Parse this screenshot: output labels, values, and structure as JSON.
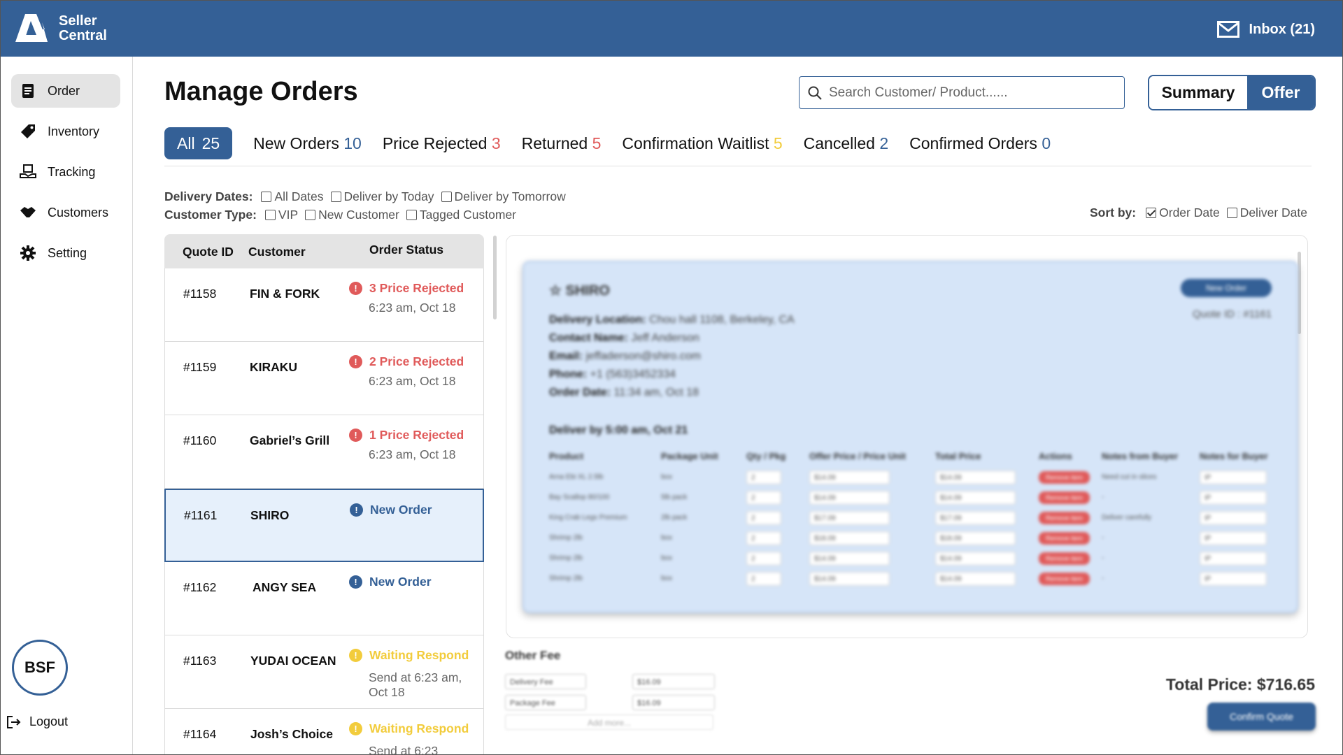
{
  "header": {
    "brand_line1": "Seller",
    "brand_line2": "Central",
    "inbox_label": "Inbox (21)"
  },
  "sidebar": {
    "items": [
      {
        "label": "Order",
        "icon": "order-icon"
      },
      {
        "label": "Inventory",
        "icon": "tag-icon"
      },
      {
        "label": "Tracking",
        "icon": "tracking-icon"
      },
      {
        "label": "Customers",
        "icon": "handshake-icon"
      },
      {
        "label": "Setting",
        "icon": "gear-icon"
      }
    ],
    "avatar": "BSF",
    "logout": "Logout"
  },
  "main": {
    "title": "Manage Orders",
    "search_placeholder": "Search Customer/ Product......",
    "view_toggle": {
      "summary": "Summary",
      "offer": "Offer"
    },
    "tabs": [
      {
        "label": "All",
        "count": "25"
      },
      {
        "label": "New Orders",
        "count": "10"
      },
      {
        "label": "Price Rejected",
        "count": "3"
      },
      {
        "label": "Returned",
        "count": "5"
      },
      {
        "label": "Confirmation Waitlist",
        "count": "5"
      },
      {
        "label": "Cancelled",
        "count": "2"
      },
      {
        "label": "Confirmed Orders",
        "count": "0"
      }
    ],
    "filters": {
      "delivery_label": "Delivery Dates:",
      "delivery_options": [
        "All Dates",
        "Deliver by Today",
        "Deliver by Tomorrow"
      ],
      "customer_label": "Customer Type:",
      "customer_options": [
        "VIP",
        "New Customer",
        "Tagged Customer"
      ],
      "sort_label": "Sort by:",
      "sort_options": [
        "Order Date",
        "Deliver Date"
      ]
    },
    "list": {
      "headers": [
        "Quote ID",
        "Customer",
        "Order Status"
      ],
      "rows": [
        {
          "id": "#1158",
          "customer": "FIN & FORK",
          "status": "3 Price Rejected",
          "time": "6:23 am, Oct 18"
        },
        {
          "id": "#1159",
          "customer": "KIRAKU",
          "status": "2 Price Rejected",
          "time": "6:23 am, Oct 18"
        },
        {
          "id": "#1160",
          "customer": "Gabriel’s Grill",
          "status": "1 Price Rejected",
          "time": "6:23 am, Oct 18"
        },
        {
          "id": "#1161",
          "customer": "SHIRO",
          "status": "New Order",
          "time": ""
        },
        {
          "id": "#1162",
          "customer": "ANGY SEA",
          "status": "New Order",
          "time": ""
        },
        {
          "id": "#1163",
          "customer": "YUDAI OCEAN",
          "status": "Waiting Respond",
          "time": "Send at 6:23 am, Oct 18"
        },
        {
          "id": "#1164",
          "customer": "Josh’s Choice",
          "status": "Waiting Respond",
          "time": "Send at 6:23"
        }
      ]
    },
    "detail": {
      "shop": "SHIRO",
      "new_order_btn": "New Order",
      "quote_ref": "Quote ID : #1161",
      "delivery_location_label": "Delivery Location:",
      "delivery_location": "Chou hall 1108, Berkeley, CA",
      "contact_label": "Contact Name:",
      "contact": "Jeff Anderson",
      "email_label": "Email:",
      "email": "jeffaderson@shiro.com",
      "phone_label": "Phone:",
      "phone": "+1 (563)3452334",
      "order_date_label": "Order Date:",
      "order_date": "11:34 am, Oct 18",
      "deliver_by": "Deliver by 5:00 am, Oct 21",
      "table_headers": [
        "Product",
        "Package Unit",
        "Qty / Pkg",
        "Offer Price / Price Unit",
        "Total Price",
        "Actions",
        "Notes from Buyer",
        "Notes for Buyer"
      ],
      "rows": [
        {
          "product": "Arna Ebi XL 2.5lb",
          "unit": "box",
          "qty": "2",
          "price": "$14.09",
          "total": "$14.09",
          "action": "Remove item",
          "note_from": "Need cut in slices",
          "note_for": "IP"
        },
        {
          "product": "Bay Scallop 80/100",
          "unit": "5lb pack",
          "qty": "2",
          "price": "$14.09",
          "total": "$14.09",
          "action": "Remove item",
          "note_from": "-",
          "note_for": "IP"
        },
        {
          "product": "King Crab Legs Premium",
          "unit": "2lb pack",
          "qty": "2",
          "price": "$17.09",
          "total": "$17.09",
          "action": "Remove item",
          "note_from": "Deliver carefully",
          "note_for": "IP"
        },
        {
          "product": "Shrimp 2lb",
          "unit": "box",
          "qty": "2",
          "price": "$18.09",
          "total": "$18.09",
          "action": "Remove item",
          "note_from": "-",
          "note_for": "IP"
        },
        {
          "product": "Shrimp 2lb",
          "unit": "box",
          "qty": "2",
          "price": "$14.09",
          "total": "$14.09",
          "action": "Remove item",
          "note_from": "-",
          "note_for": "IP"
        },
        {
          "product": "Shrimp 2lb",
          "unit": "box",
          "qty": "2",
          "price": "$14.09",
          "total": "$14.09",
          "action": "Remove item",
          "note_from": "-",
          "note_for": "IP"
        }
      ]
    },
    "other_fee": {
      "title": "Other Fee",
      "fees": [
        {
          "name": "Delivery Fee",
          "amount": "$16.09"
        },
        {
          "name": "Package Fee",
          "amount": "$16.09"
        }
      ],
      "add_more": "Add more..."
    },
    "total_label": "Total Price:",
    "total_value": "$716.65",
    "confirm_btn": "Confirm Quote"
  },
  "colors": {
    "brand": "#346096",
    "rejected": "#e05a5a",
    "waiting": "#f2cc3c",
    "selected_bg": "#e6f0fb"
  }
}
